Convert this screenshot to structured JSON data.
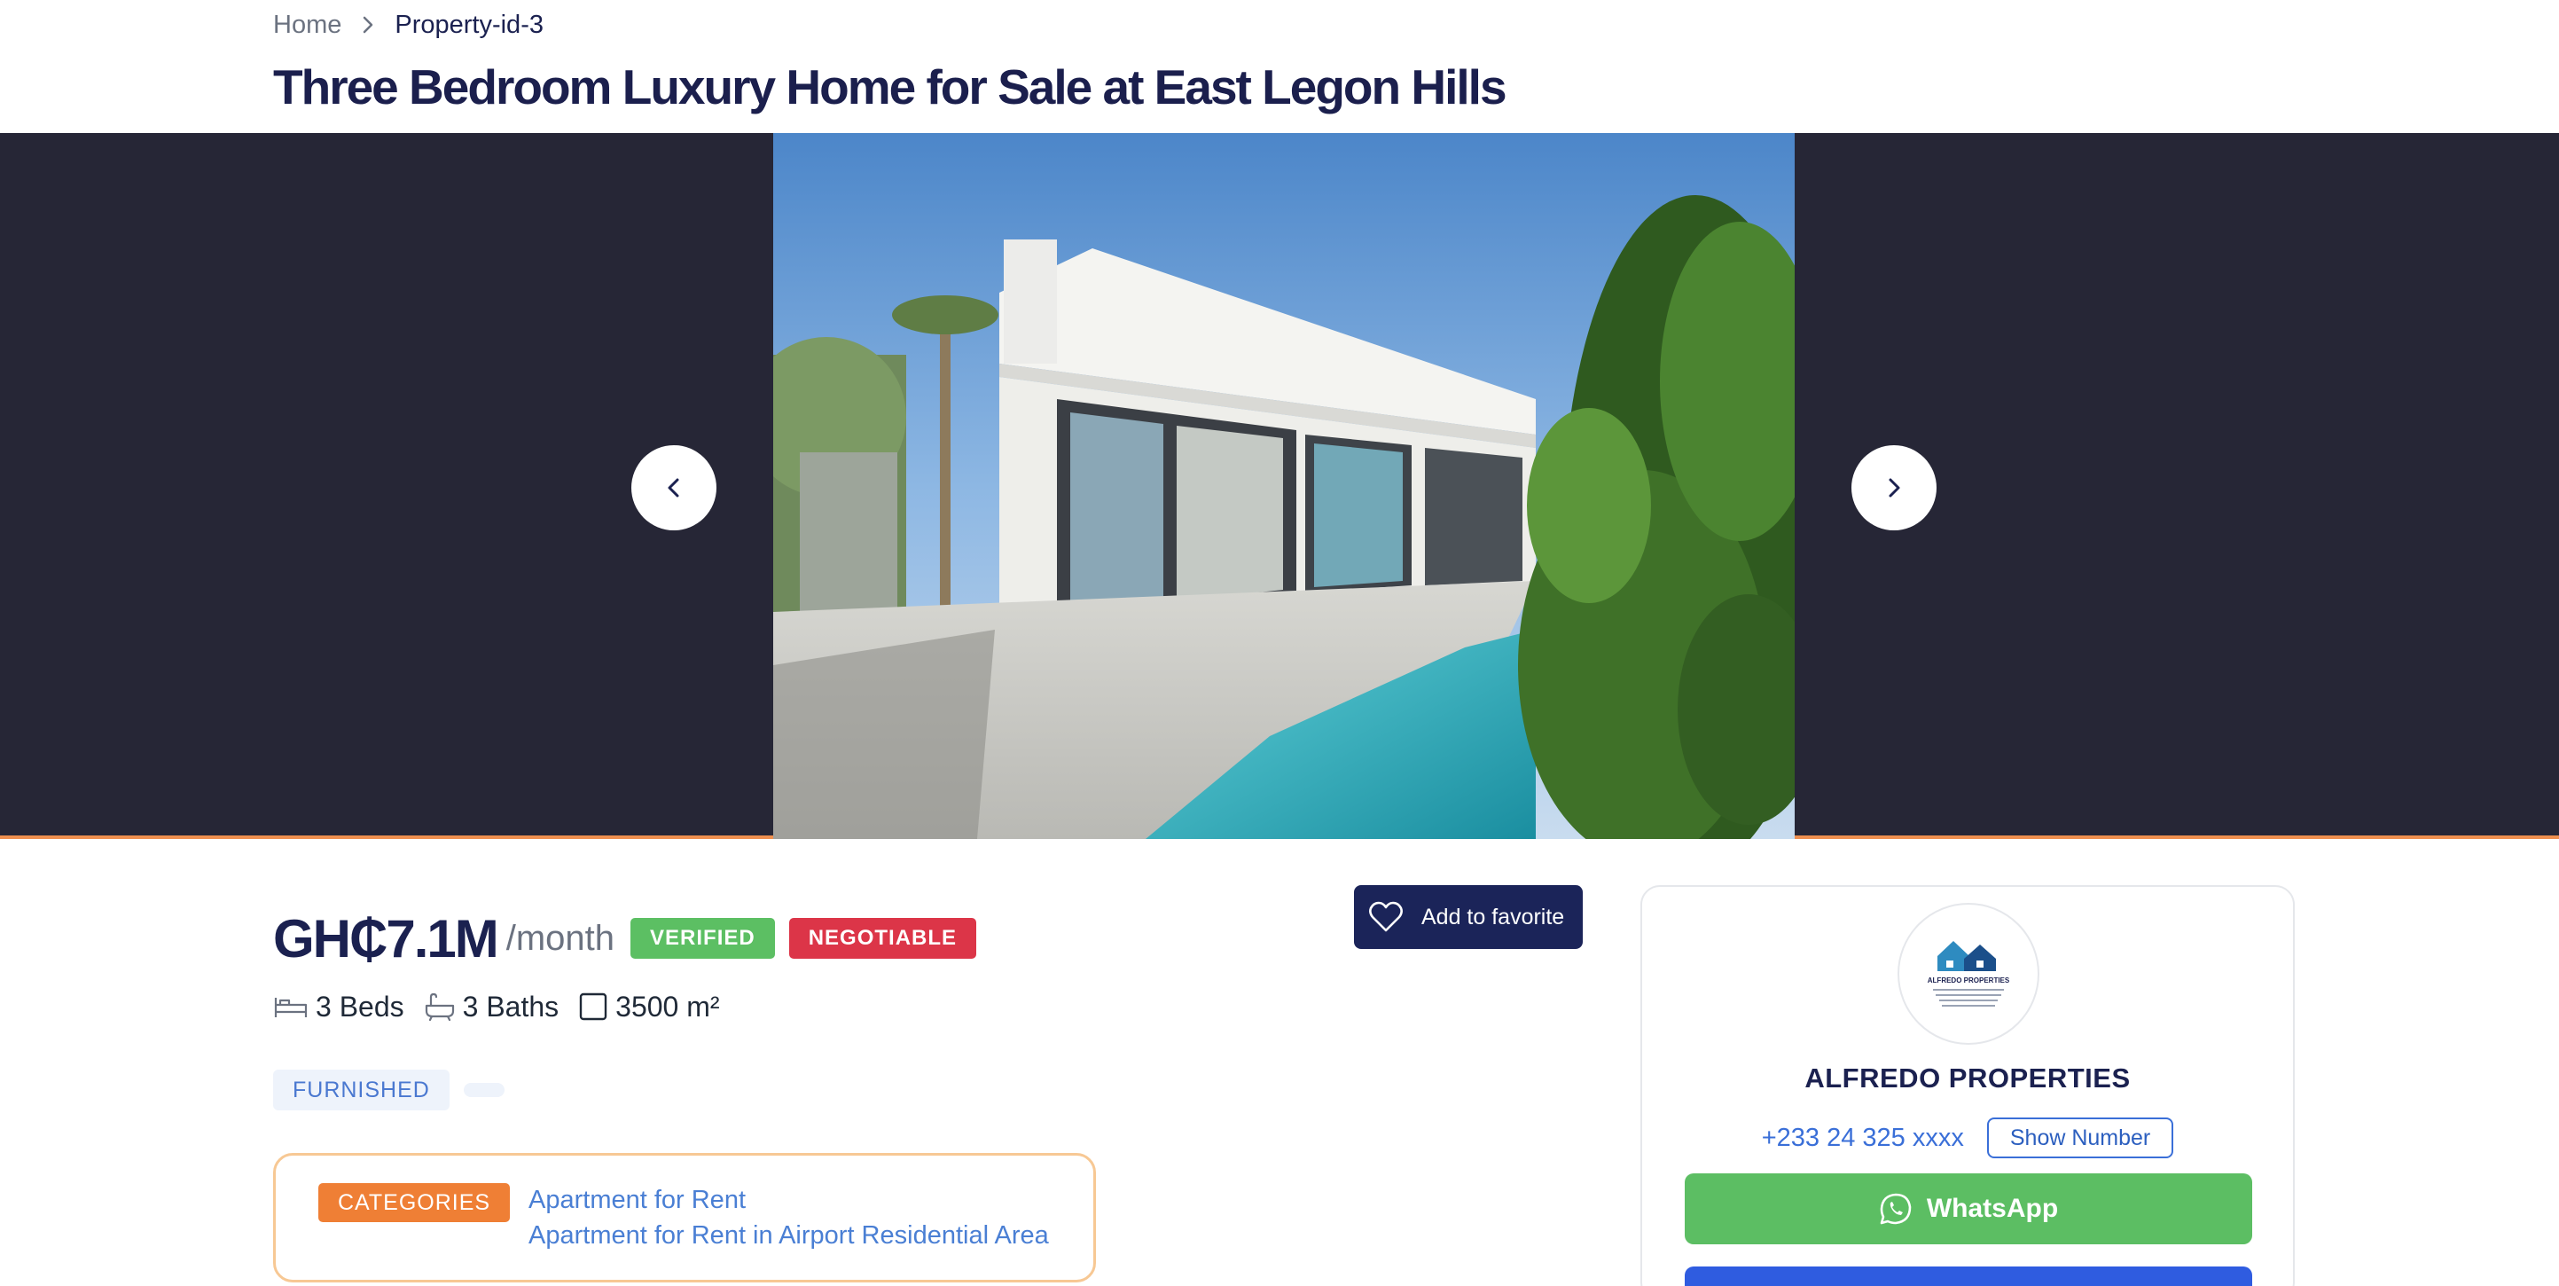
{
  "breadcrumb": {
    "home": "Home",
    "current": "Property-id-3"
  },
  "title": "Three Bedroom Luxury Home for Sale at East Legon Hills",
  "listing": {
    "price": "GH₵7.1M",
    "price_unit": "/month",
    "badges": {
      "verified": "VERIFIED",
      "negotiable": "NEGOTIABLE"
    },
    "specs": {
      "beds": "3 Beds",
      "baths": "3 Baths",
      "area": "3500 m²"
    },
    "tags": [
      "FURNISHED"
    ],
    "categories_label": "CATEGORIES",
    "categories": [
      "Apartment for Rent",
      "Apartment for Rent in Airport Residential Area"
    ],
    "favorite_label": "Add to favorite"
  },
  "agent": {
    "name": "ALFREDO PROPERTIES",
    "logo_text": "ALFREDO PROPERTIES",
    "phone": "+233 24 325 xxxx",
    "show_number": "Show Number",
    "whatsapp": "WhatsApp"
  },
  "colors": {
    "navy": "#1b2150",
    "accent_orange": "#ef7f35",
    "verified_green": "#5cbf63",
    "negotiable_red": "#dc3548",
    "whatsapp_green": "#5cbe63",
    "link_blue": "#4a7fd4"
  },
  "icons": [
    "chevron-right-icon",
    "chevron-left-icon",
    "bed-icon",
    "bath-icon",
    "area-icon",
    "heart-icon",
    "whatsapp-icon"
  ]
}
